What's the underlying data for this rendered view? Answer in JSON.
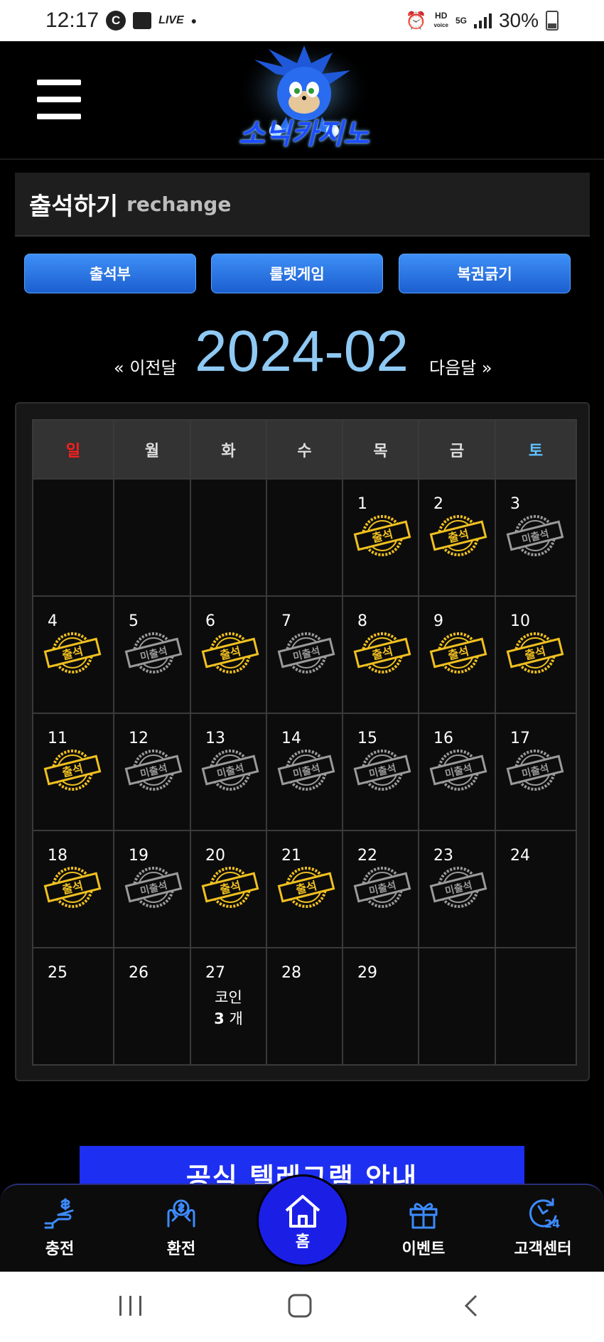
{
  "status_bar": {
    "time": "12:17",
    "live": "LIVE",
    "net": "5G",
    "hd": "HD",
    "voice": "voice",
    "battery": "30%"
  },
  "header": {
    "logo_text": "소닉카지노"
  },
  "page": {
    "title": "출석하기",
    "subtitle": "rechange"
  },
  "tabs": [
    {
      "label": "출석부"
    },
    {
      "label": "룰렛게임"
    },
    {
      "label": "복권긁기"
    }
  ],
  "month_nav": {
    "prev": "« 이전달",
    "current": "2024-02",
    "next": "다음달 »"
  },
  "calendar": {
    "weekdays": [
      "일",
      "월",
      "화",
      "수",
      "목",
      "금",
      "토"
    ],
    "weekday_colors": {
      "sunday": "#ff1e1e",
      "saturday": "#5fc3ff"
    },
    "stamp_labels": {
      "attended": "출석",
      "absent": "미출석"
    },
    "stamp_colors": {
      "attended": "#f0c020",
      "absent": "#9a9a9a"
    },
    "weeks": [
      [
        {
          "day": ""
        },
        {
          "day": ""
        },
        {
          "day": ""
        },
        {
          "day": ""
        },
        {
          "day": "1",
          "status": "attended"
        },
        {
          "day": "2",
          "status": "attended"
        },
        {
          "day": "3",
          "status": "absent"
        }
      ],
      [
        {
          "day": "4",
          "status": "attended"
        },
        {
          "day": "5",
          "status": "absent"
        },
        {
          "day": "6",
          "status": "attended"
        },
        {
          "day": "7",
          "status": "absent"
        },
        {
          "day": "8",
          "status": "attended"
        },
        {
          "day": "9",
          "status": "attended"
        },
        {
          "day": "10",
          "status": "attended"
        }
      ],
      [
        {
          "day": "11",
          "status": "attended"
        },
        {
          "day": "12",
          "status": "absent"
        },
        {
          "day": "13",
          "status": "absent"
        },
        {
          "day": "14",
          "status": "absent"
        },
        {
          "day": "15",
          "status": "absent"
        },
        {
          "day": "16",
          "status": "absent"
        },
        {
          "day": "17",
          "status": "absent"
        }
      ],
      [
        {
          "day": "18",
          "status": "attended"
        },
        {
          "day": "19",
          "status": "absent"
        },
        {
          "day": "20",
          "status": "attended"
        },
        {
          "day": "21",
          "status": "attended"
        },
        {
          "day": "22",
          "status": "absent"
        },
        {
          "day": "23",
          "status": "absent"
        },
        {
          "day": "24"
        }
      ],
      [
        {
          "day": "25"
        },
        {
          "day": "26"
        },
        {
          "day": "27",
          "coin_label": "코인",
          "coin_count": "3",
          "coin_unit": "개"
        },
        {
          "day": "28"
        },
        {
          "day": "29"
        },
        {
          "day": ""
        },
        {
          "day": ""
        }
      ]
    ]
  },
  "banner": {
    "text": "공식 텔레그램 안내"
  },
  "bottom_nav": {
    "items": [
      {
        "label": "충전",
        "icon": "charge-icon"
      },
      {
        "label": "환전",
        "icon": "exchange-icon"
      },
      {
        "label": "홈",
        "icon": "home-icon"
      },
      {
        "label": "이벤트",
        "icon": "gift-icon"
      },
      {
        "label": "고객센터",
        "icon": "support-24-icon"
      }
    ]
  },
  "system_nav": {
    "recents": "recents-icon",
    "home": "home-square-icon",
    "back": "back-icon"
  }
}
